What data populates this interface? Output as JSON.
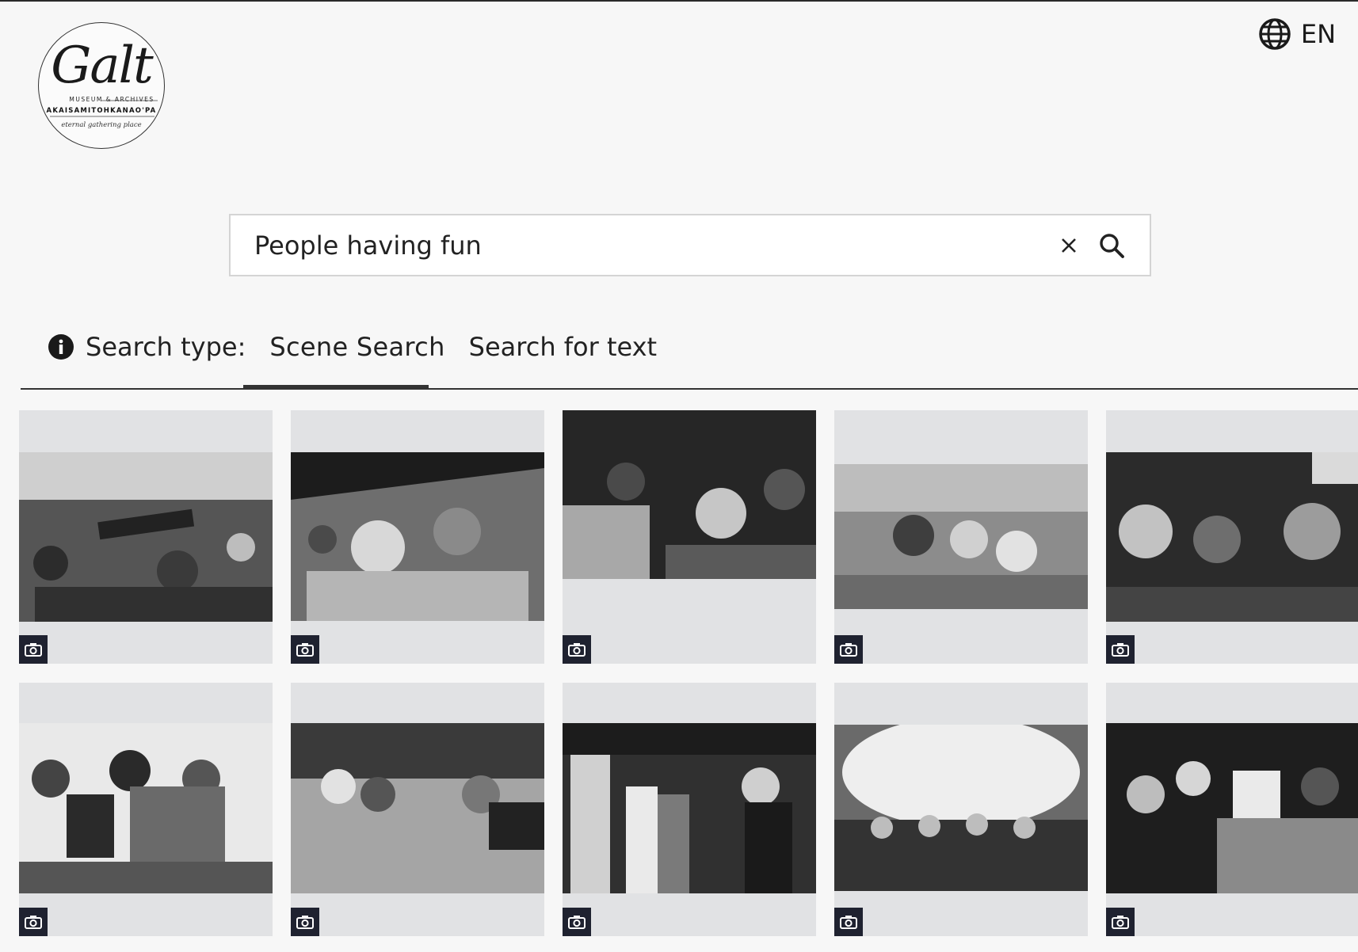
{
  "header": {
    "logo": {
      "script": "Galt",
      "line1": "MUSEUM & ARCHIVES",
      "line2": "AKAISAMITOHKANAO'PA",
      "line3": "eternal gathering place"
    },
    "language": {
      "icon": "globe-icon",
      "label": "EN"
    }
  },
  "search": {
    "value": "People having fun",
    "placeholder": "",
    "clear_icon": "close-icon",
    "submit_icon": "search-icon"
  },
  "search_type": {
    "info_icon": "info-icon",
    "label": "Search type:",
    "tabs": [
      {
        "label": "Scene Search",
        "active": true
      },
      {
        "label": "Search for text",
        "active": false
      }
    ]
  },
  "results": {
    "media_icon": "camera-icon",
    "items": [
      {
        "type": "photo"
      },
      {
        "type": "photo"
      },
      {
        "type": "photo"
      },
      {
        "type": "photo"
      },
      {
        "type": "photo"
      },
      {
        "type": "photo"
      },
      {
        "type": "photo"
      },
      {
        "type": "photo"
      },
      {
        "type": "photo"
      },
      {
        "type": "photo"
      }
    ]
  },
  "colors": {
    "background": "#f7f7f7",
    "card": "#e1e2e4",
    "badge": "#1f2230",
    "accent": "#333333"
  }
}
